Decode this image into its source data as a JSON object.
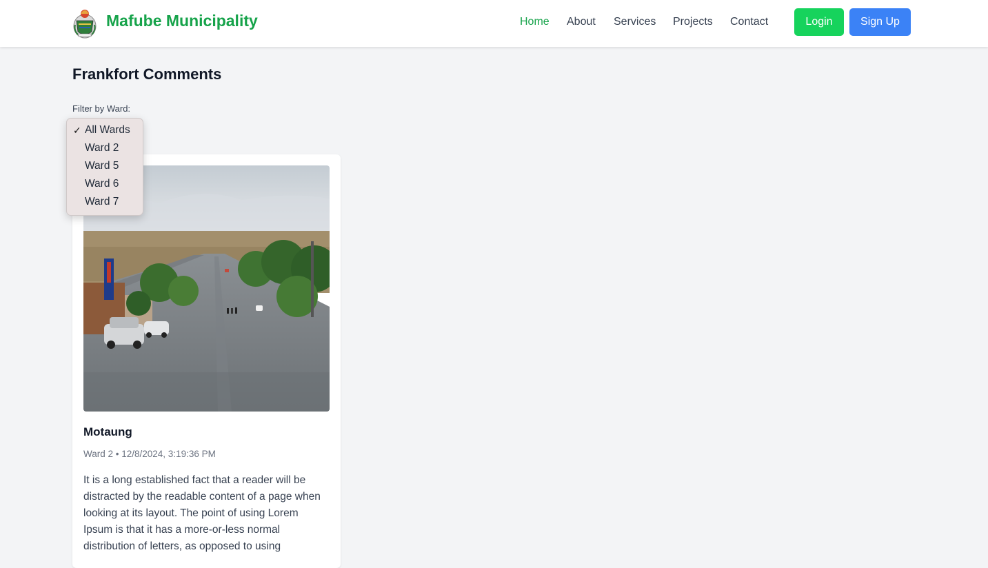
{
  "navbar": {
    "brand": "Mafube Municipality",
    "links": [
      {
        "label": "Home",
        "active": true
      },
      {
        "label": "About",
        "active": false
      },
      {
        "label": "Services",
        "active": false
      },
      {
        "label": "Projects",
        "active": false
      },
      {
        "label": "Contact",
        "active": false
      }
    ],
    "login_label": "Login",
    "signup_label": "Sign Up"
  },
  "page": {
    "title": "Frankfort Comments",
    "filter_label": "Filter by Ward:"
  },
  "ward_filter": {
    "selected": "All Wards",
    "options": [
      "All Wards",
      "Ward 2",
      "Ward 5",
      "Ward 6",
      "Ward 7"
    ]
  },
  "comments": [
    {
      "author": "Motaung",
      "meta": "Ward 2 • 12/8/2024, 3:19:36 PM",
      "body": "It is a long established fact that a reader will be distracted by the readable content of a page when looking at its layout. The point of using Lorem Ipsum is that it has a more-or-less normal distribution of letters, as opposed to using"
    }
  ],
  "colors": {
    "brand_green": "#16a34a",
    "login_button": "#16d35c",
    "signup_button": "#3b82f6",
    "page_background": "#f3f4f6"
  },
  "icons": [
    "municipal-crest-logo",
    "check-icon"
  ]
}
